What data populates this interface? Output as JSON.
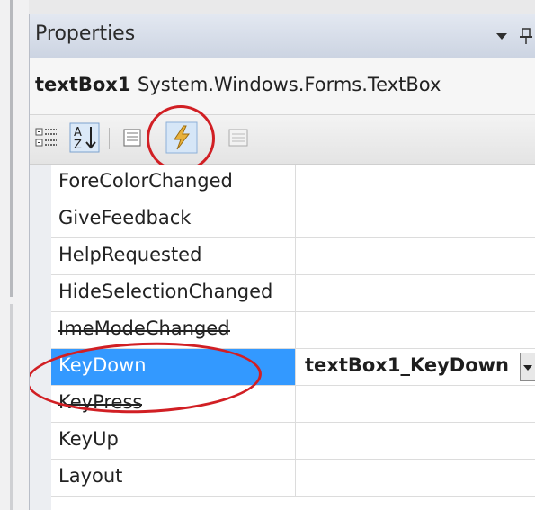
{
  "panel": {
    "title": "Properties",
    "dropdown_icon": "dropdown-arrow-icon",
    "pin_icon": "pin-icon"
  },
  "object": {
    "name": "textBox1",
    "type": "System.Windows.Forms.TextBox"
  },
  "toolbar": {
    "buttons": [
      {
        "icon": "categorized-icon",
        "active": false
      },
      {
        "icon": "alphabetical-icon",
        "active": true
      },
      {
        "icon": "properties-icon",
        "active": false
      },
      {
        "icon": "events-lightning-icon",
        "active": true
      },
      {
        "icon": "property-pages-icon",
        "active": false
      }
    ]
  },
  "events": {
    "rows": [
      {
        "name": "ForeColorChanged",
        "value": ""
      },
      {
        "name": "GiveFeedback",
        "value": ""
      },
      {
        "name": "HelpRequested",
        "value": ""
      },
      {
        "name": "HideSelectionChanged",
        "value": ""
      },
      {
        "name": "ImeModeChanged",
        "value": ""
      },
      {
        "name": "KeyDown",
        "value": "textBox1_KeyDown",
        "selected": true
      },
      {
        "name": "KeyPress",
        "value": ""
      },
      {
        "name": "KeyUp",
        "value": ""
      },
      {
        "name": "Layout",
        "value": ""
      }
    ]
  },
  "annotations": {
    "highlight_color": "#d11f24",
    "selection_color": "#3399ff"
  }
}
